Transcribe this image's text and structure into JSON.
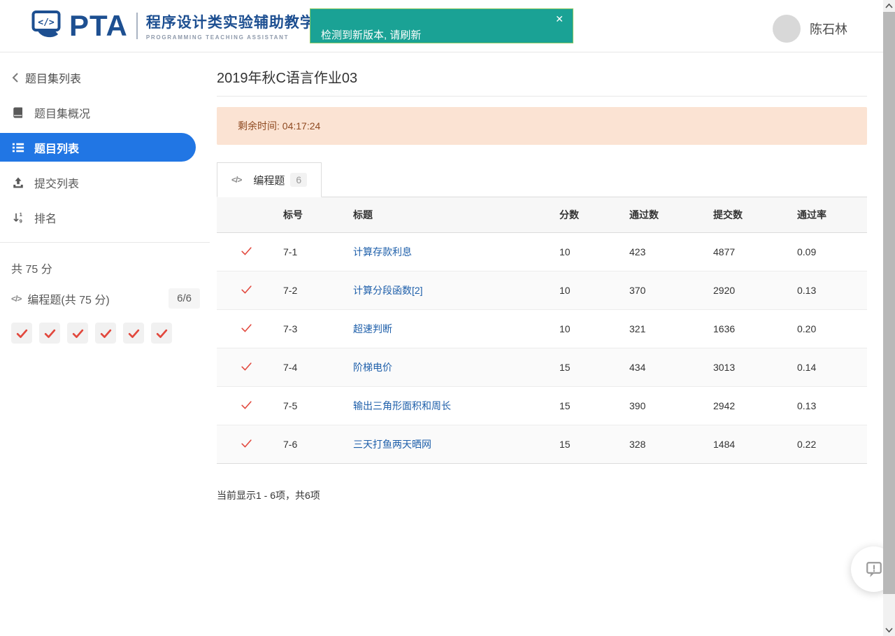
{
  "header": {
    "logo": {
      "brand": "PTA",
      "subtitle_cn": "程序设计类实验辅助教学平",
      "subtitle_en": "PROGRAMMING TEACHING ASSISTANT"
    },
    "notification": {
      "message": "检测到新版本, 请刷新",
      "close": "✕"
    },
    "user": {
      "name": "陈石林"
    }
  },
  "sidebar": {
    "back_label": "题目集列表",
    "items": [
      {
        "label": "题目集概况",
        "icon": "book-icon"
      },
      {
        "label": "题目列表",
        "icon": "list-icon",
        "active": true
      },
      {
        "label": "提交列表",
        "icon": "upload-icon"
      },
      {
        "label": "排名",
        "icon": "sort-numeric-icon"
      }
    ],
    "summary": {
      "total_score": "共 75 分",
      "section_icon": "code-icon",
      "section_label": "编程题(共 75 分)",
      "progress_badge": "6/6",
      "solved_count": 6
    }
  },
  "main": {
    "title": "2019年秋C语言作业03",
    "alert_text": "剩余时间: 04:17:24",
    "tab": {
      "icon": "code-icon",
      "label": "编程题",
      "badge": "6"
    },
    "table": {
      "headers": [
        "标号",
        "标题",
        "分数",
        "通过数",
        "提交数",
        "通过率"
      ],
      "rows": [
        {
          "id": "7-1",
          "title": "计算存款利息",
          "score": "10",
          "passed": "423",
          "submitted": "4877",
          "rate": "0.09"
        },
        {
          "id": "7-2",
          "title": "计算分段函数[2]",
          "score": "10",
          "passed": "370",
          "submitted": "2920",
          "rate": "0.13"
        },
        {
          "id": "7-3",
          "title": "超速判断",
          "score": "10",
          "passed": "321",
          "submitted": "1636",
          "rate": "0.20"
        },
        {
          "id": "7-4",
          "title": "阶梯电价",
          "score": "15",
          "passed": "434",
          "submitted": "3013",
          "rate": "0.14"
        },
        {
          "id": "7-5",
          "title": "输出三角形面积和周长",
          "score": "15",
          "passed": "390",
          "submitted": "2942",
          "rate": "0.13"
        },
        {
          "id": "7-6",
          "title": "三天打鱼两天晒网",
          "score": "15",
          "passed": "328",
          "submitted": "1484",
          "rate": "0.22"
        }
      ]
    },
    "pagination_text": "当前显示1 - 6项，共6项"
  },
  "colors": {
    "accent_blue": "#2176e4",
    "brand_navy": "#1d4f91",
    "toast_teal": "#1aa295",
    "alert_bg": "#fbe3d3",
    "alert_text": "#8f4a21",
    "link_blue": "#1e5faa",
    "check_red": "#e2483d"
  }
}
